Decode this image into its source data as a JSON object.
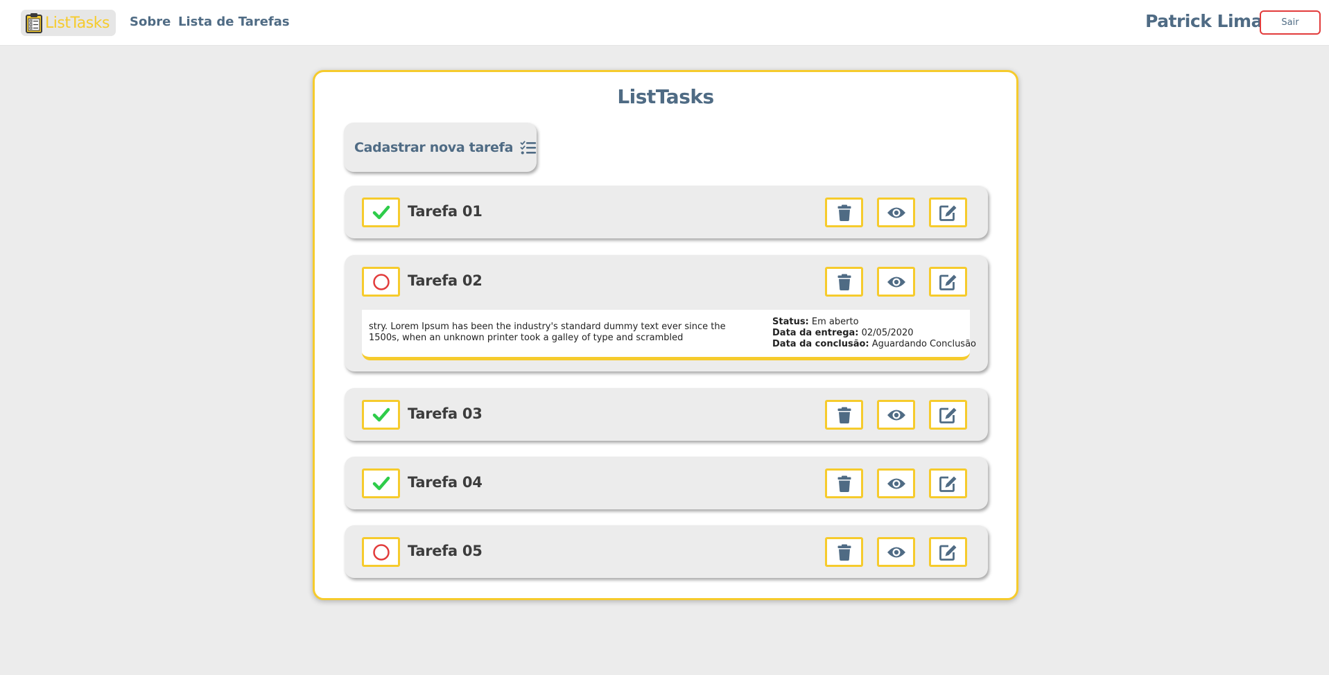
{
  "header": {
    "brand": "ListTasks",
    "nav": [
      "Sobre",
      "Lista de Tarefas"
    ],
    "user_name": "Patrick Lima",
    "logout_label": "Sair"
  },
  "panel": {
    "title": "ListTasks",
    "new_task_label": "Cadastrar nova tarefa"
  },
  "tasks": [
    {
      "title": "Tarefa 01",
      "done": true
    },
    {
      "title": "Tarefa 02",
      "done": false,
      "description": "stry. Lorem Ipsum has been the industry's standard dummy text ever since the 1500s, when an unknown printer took a galley of type and scrambled",
      "status_label": "Status:",
      "status_value": "Em aberto",
      "due_label": "Data da entrega:",
      "due_value": "02/05/2020",
      "done_label": "Data da conclusão:",
      "done_value": "Aguardando Conclusão"
    },
    {
      "title": "Tarefa 03",
      "done": true
    },
    {
      "title": "Tarefa 04",
      "done": true
    },
    {
      "title": "Tarefa 05",
      "done": false
    }
  ],
  "colors": {
    "accent": "#f6cb2c",
    "primary_text": "#4f6b84",
    "done": "#2ecc4a",
    "pending": "#e23b3b",
    "background": "#ececec"
  },
  "icons": {
    "brand": "clipboard-list-icon",
    "new_task": "tasks-list-icon",
    "done": "check-icon",
    "pending": "circle-icon",
    "delete": "trash-icon",
    "view": "eye-icon",
    "edit": "edit-icon"
  }
}
